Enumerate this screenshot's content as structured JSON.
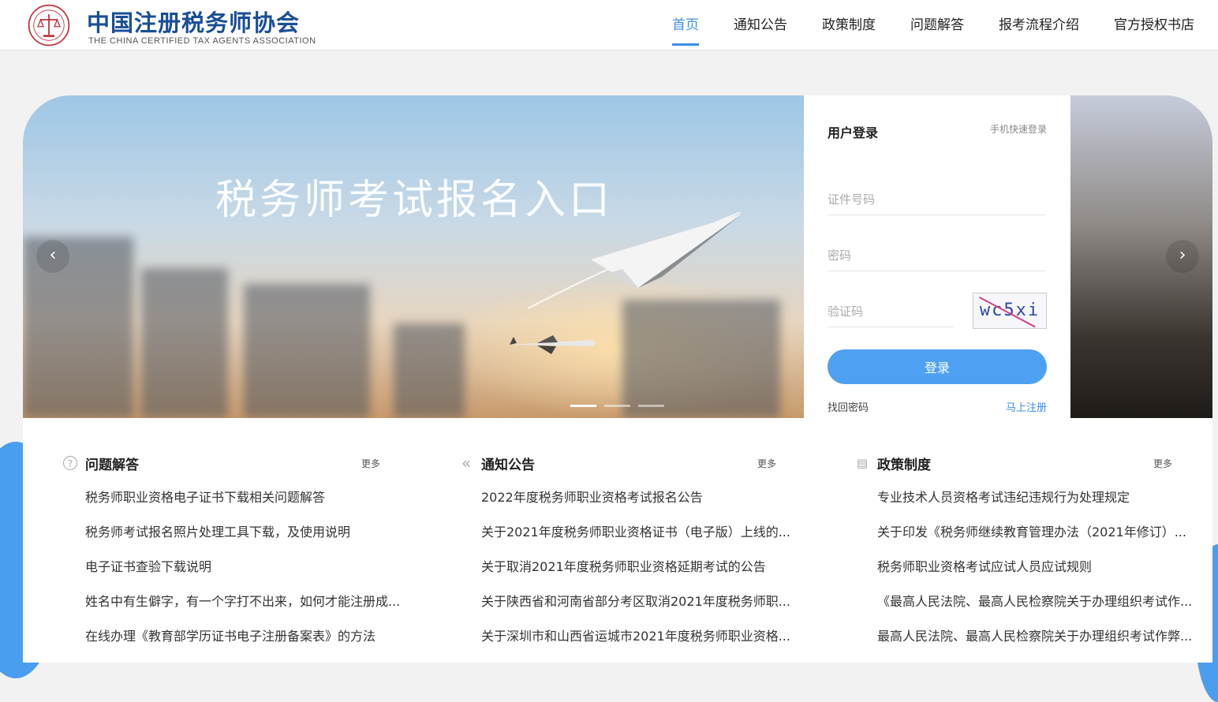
{
  "header": {
    "brand_cn": "中国注册税务师协会",
    "brand_en": "THE CHINA CERTIFIED TAX AGENTS ASSOCIATION",
    "nav": [
      "首页",
      "通知公告",
      "政策制度",
      "问题解答",
      "报考流程介绍",
      "官方授权书店"
    ],
    "active_nav": "首页"
  },
  "banner": {
    "title": "税务师考试报名入口",
    "prev_icon": "chevron-left-icon",
    "next_icon": "chevron-right-icon",
    "prev_glyph": "‹",
    "next_glyph": "›",
    "slide_count": 3,
    "active_slide": 1
  },
  "login": {
    "title": "用户登录",
    "quick_login": "手机快速登录",
    "id_placeholder": "证件号码",
    "password_placeholder": "密码",
    "captcha_placeholder": "验证码",
    "captcha_text": "wc5xi",
    "submit": "登录",
    "forgot": "找回密码",
    "register": "马上注册"
  },
  "columns": [
    {
      "icon": "question-circle-icon",
      "icon_glyph": "?",
      "title": "问题解答",
      "more": "更多",
      "items": [
        "税务师职业资格电子证书下载相关问题解答",
        "税务师考试报名照片处理工具下载，及使用说明",
        "电子证书查验下载说明",
        "姓名中有生僻字，有一个字打不出来，如何才能注册成...",
        "在线办理《教育部学历证书电子注册备案表》的方法"
      ]
    },
    {
      "icon": "double-chevron-left-icon",
      "icon_glyph": "«",
      "title": "通知公告",
      "more": "更多",
      "items": [
        "2022年度税务师职业资格考试报名公告",
        "关于2021年度税务师职业资格证书（电子版）上线的...",
        "关于取消2021年度税务师职业资格延期考试的公告",
        "关于陕西省和河南省部分考区取消2021年度税务师职...",
        "关于深圳市和山西省运城市2021年度税务师职业资格..."
      ]
    },
    {
      "icon": "document-icon",
      "icon_glyph": "▤",
      "title": "政策制度",
      "more": "更多",
      "items": [
        "专业技术人员资格考试违纪违规行为处理规定",
        "关于印发《税务师继续教育管理办法（2021年修订）...",
        "税务师职业资格考试应试人员应试规则",
        "《最高人民法院、最高人民检察院关于办理组织考试作...",
        "最高人民法院、最高人民检察院关于办理组织考试作弊..."
      ]
    }
  ],
  "colors": {
    "brand": "#1a4f97",
    "accent": "#3b8ee8",
    "login_button": "#4ea1f2"
  }
}
